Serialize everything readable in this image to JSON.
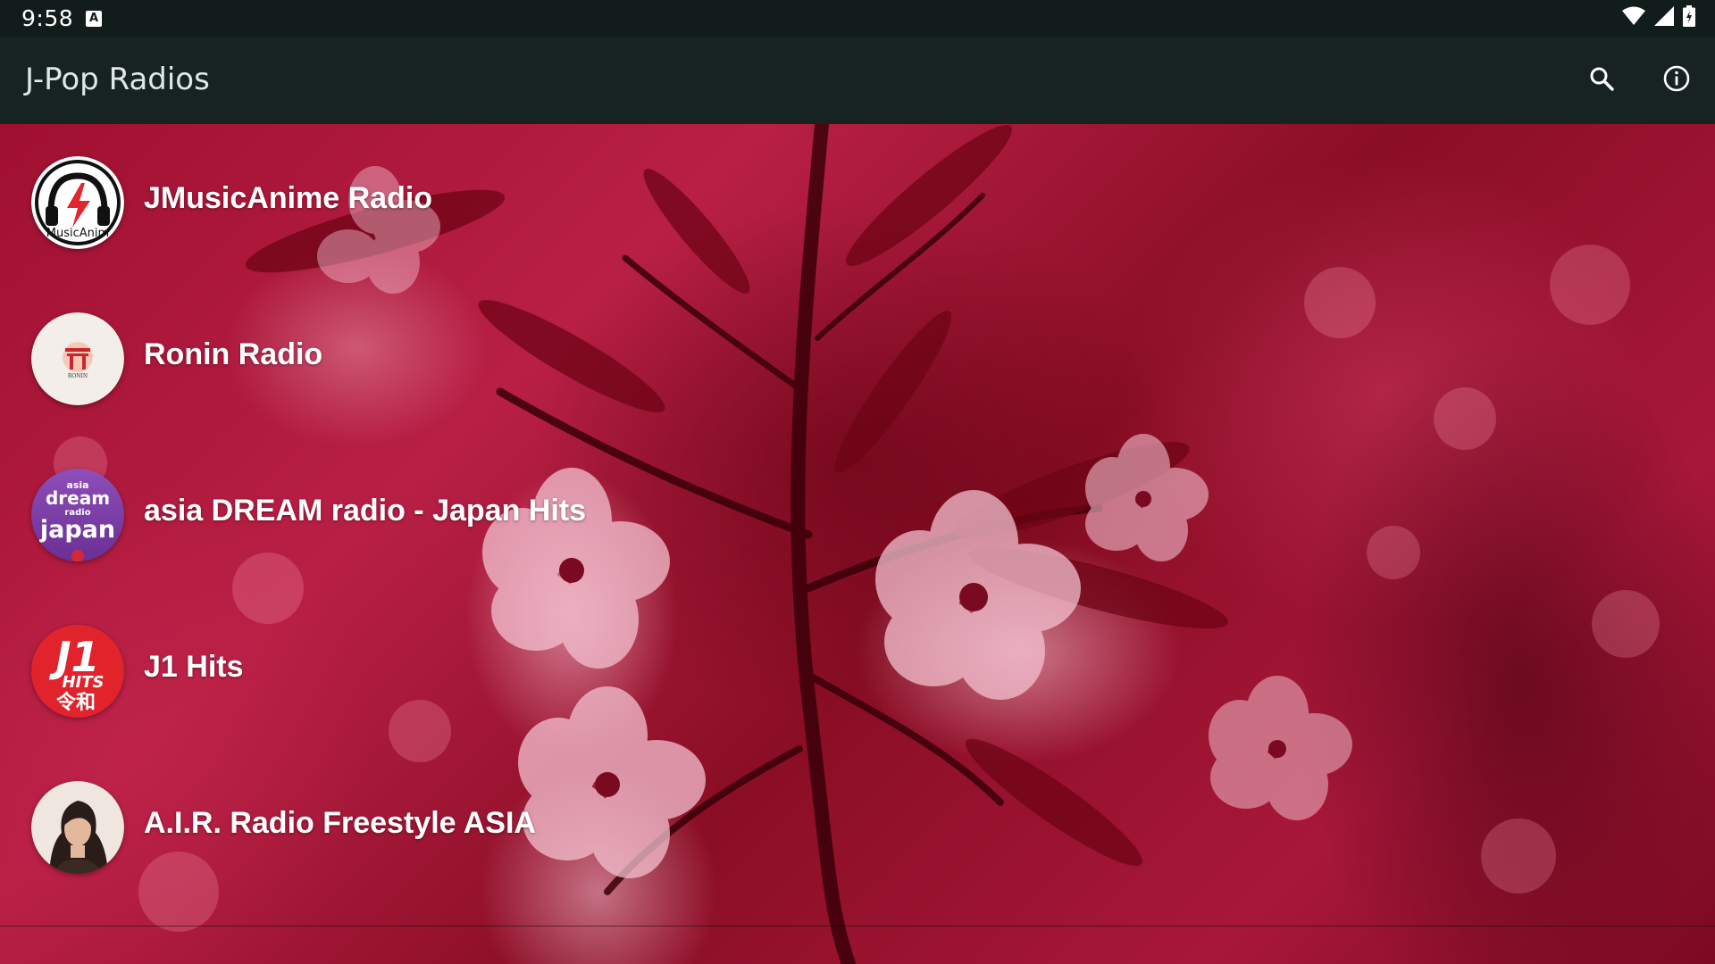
{
  "status_bar": {
    "time": "9:58",
    "notification_icon": "a-notification-icon",
    "wifi_icon": "wifi-icon",
    "signal_icon": "signal-icon",
    "battery_icon": "battery-icon"
  },
  "app_bar": {
    "title": "J-Pop Radios",
    "search_icon": "search-icon",
    "info_icon": "info-icon",
    "background": "#172321"
  },
  "stations": [
    {
      "name": "JMusicAnime Radio",
      "logo_icon": "jmusicanime-logo",
      "logo_text": "MusicAnim"
    },
    {
      "name": "Ronin Radio",
      "logo_icon": "ronin-logo",
      "logo_text": "RONIN"
    },
    {
      "name": "asia DREAM radio - Japan Hits",
      "logo_icon": "asia-dream-radio-logo",
      "logo_text_top": "asia",
      "logo_text_mid": "dream",
      "logo_text_small": "radio",
      "logo_text_bottom": "japan"
    },
    {
      "name": "J1 Hits",
      "logo_icon": "j1-hits-logo",
      "logo_text_top": "J1",
      "logo_text_mid": "HITS",
      "logo_text_bottom": "令和"
    },
    {
      "name": "A.I.R. Radio Freestyle ASIA",
      "logo_icon": "air-radio-portrait"
    }
  ],
  "colors": {
    "accent_red": "#d7262e",
    "dream_purple": "#7b3fa4",
    "background_tint": "#a01030"
  }
}
